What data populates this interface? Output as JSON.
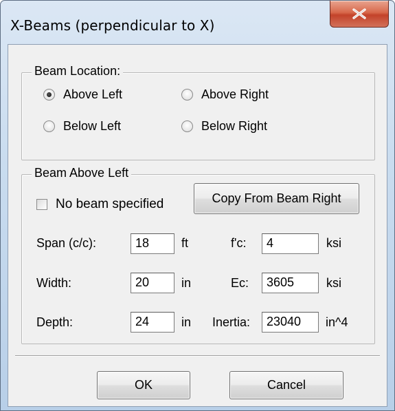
{
  "window": {
    "title": "X-Beams (perpendicular to X)",
    "accent_close": "#c7432a"
  },
  "location_group": {
    "label": "Beam Location:",
    "options": [
      {
        "label": "Above Left",
        "checked": true
      },
      {
        "label": "Above Right",
        "checked": false
      },
      {
        "label": "Below Left",
        "checked": false
      },
      {
        "label": "Below Right",
        "checked": false
      }
    ]
  },
  "beam_group": {
    "label": "Beam Above Left",
    "no_beam": {
      "label": "No beam specified",
      "checked": false
    },
    "copy_button": "Copy From Beam Right",
    "span": {
      "label": "Span (c/c):",
      "value": "18",
      "unit": "ft"
    },
    "width": {
      "label": "Width:",
      "value": "20",
      "unit": "in"
    },
    "depth": {
      "label": "Depth:",
      "value": "24",
      "unit": "in"
    },
    "fc": {
      "label": "f'c:",
      "value": "4",
      "unit": "ksi"
    },
    "ec": {
      "label": "Ec:",
      "value": "3605",
      "unit": "ksi"
    },
    "inertia": {
      "label": "Inertia:",
      "value": "23040",
      "unit": "in^4"
    }
  },
  "buttons": {
    "ok": "OK",
    "cancel": "Cancel"
  }
}
